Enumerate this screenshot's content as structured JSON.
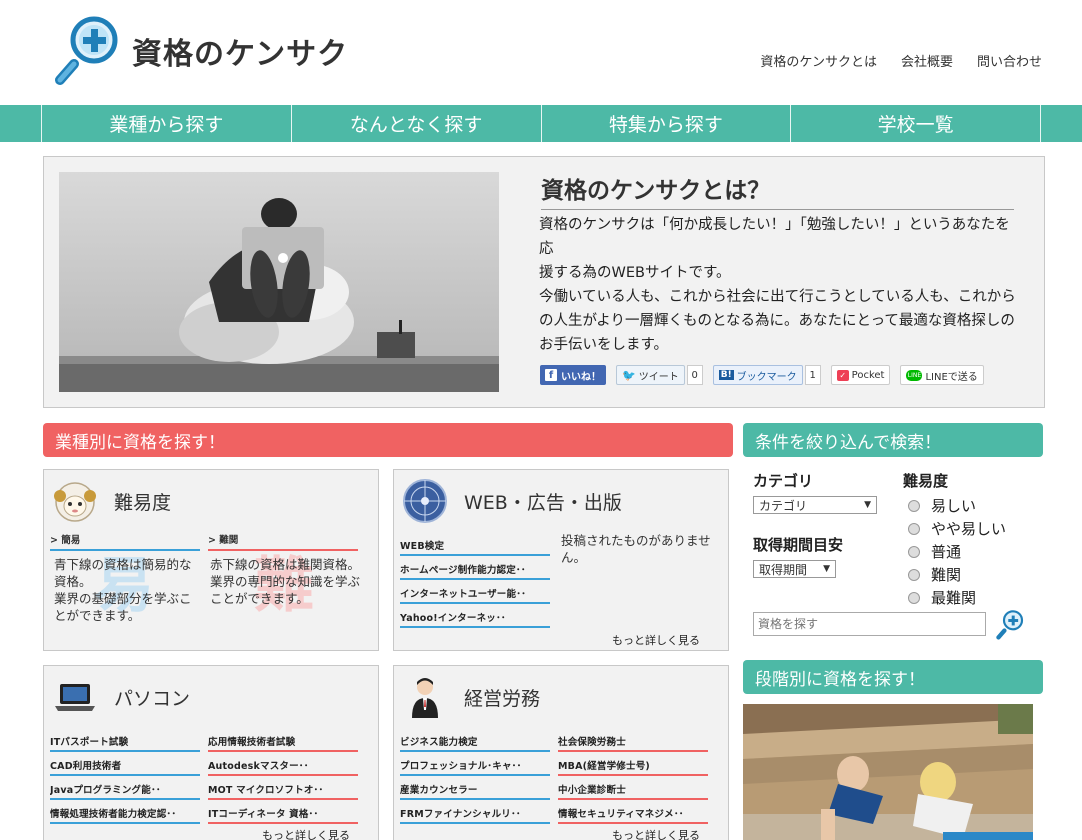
{
  "site": {
    "logo_text": "資格のケンサク"
  },
  "toplinks": [
    "資格のケンサクとは",
    "会社概要",
    "問い合わせ"
  ],
  "nav": [
    "業種から探す",
    "なんとなく探す",
    "特集から探す",
    "学校一覧"
  ],
  "hero": {
    "title": "資格のケンサクとは？",
    "desc": [
      "資格のケンサクは「何か成長したい！」「勉強したい！」というあなたを応",
      "援する為のWEBサイトです。",
      "今働いている人も、これから社会に出て行こうとしている人も、これから",
      "の人生がより一層輝くものとなる為に。あなたにとって最適な資格探しの",
      "お手伝いをします。"
    ],
    "share": {
      "like": "いいね！",
      "tweet": "ツイート",
      "tweet_count": "0",
      "hatena": "ブックマーク",
      "hatena_count": "1",
      "pocket": "Pocket",
      "line": "LINEで送る"
    }
  },
  "section_industry": "業種別に資格を探す！",
  "section_filter": "条件を絞り込んで検索！",
  "section_stage": "段階別に資格を探す！",
  "cards": {
    "difficulty": {
      "title": "難易度",
      "easy_link": "> 簡易",
      "hard_link": "> 難関",
      "easy_text": "青下線の資格は簡易的な資格。\n業界の基礎部分を学ぶことができます。",
      "hard_text": "赤下線の資格は難関資格。\n業界の専門的な知識を学ぶことができます。",
      "watermark_easy": "易",
      "watermark_hard": "難"
    },
    "web": {
      "title": "WEB・広告・出版",
      "links": [
        "WEB検定",
        "ホームページ制作能力認定･･",
        "インターネットユーザー能･･",
        "Yahoo!インターネッ･･"
      ],
      "empty": "投稿されたものがありません。",
      "more": "もっと詳しく見る"
    },
    "pc": {
      "title": "パソコン",
      "left": [
        "ITパスポート試験",
        "CAD利用技術者",
        "Javaプログラミング能･･",
        "情報処理技術者能力検定認･･"
      ],
      "right": [
        "応用情報技術者試験",
        "Autodeskマスター･･",
        "MOT マイクロソフトオ･･",
        "ITコーディネータ 資格･･"
      ],
      "more": "もっと詳しく見る"
    },
    "mgmt": {
      "title": "経営労務",
      "left": [
        "ビジネス能力検定",
        "プロフェッショナル･キャ･･",
        "産業カウンセラー",
        "FRMファイナンシャルリ･･"
      ],
      "right": [
        "社会保険労務士",
        "MBA(経営学修士号)",
        "中小企業診断士",
        "情報セキュリティマネジメ･･"
      ],
      "more": "もっと詳しく見る"
    }
  },
  "search": {
    "category_label": "カテゴリ",
    "category_value": "カテゴリ",
    "period_label": "取得期間目安",
    "period_value": "取得期間",
    "difficulty_label": "難易度",
    "difficulty_options": [
      "易しい",
      "やや易しい",
      "普通",
      "難関",
      "最難関"
    ],
    "input_placeholder": "資格を探す"
  },
  "colors": {
    "accent_green": "#4db9a6",
    "accent_red": "#f06262",
    "link_blue": "#3aa0d8"
  }
}
